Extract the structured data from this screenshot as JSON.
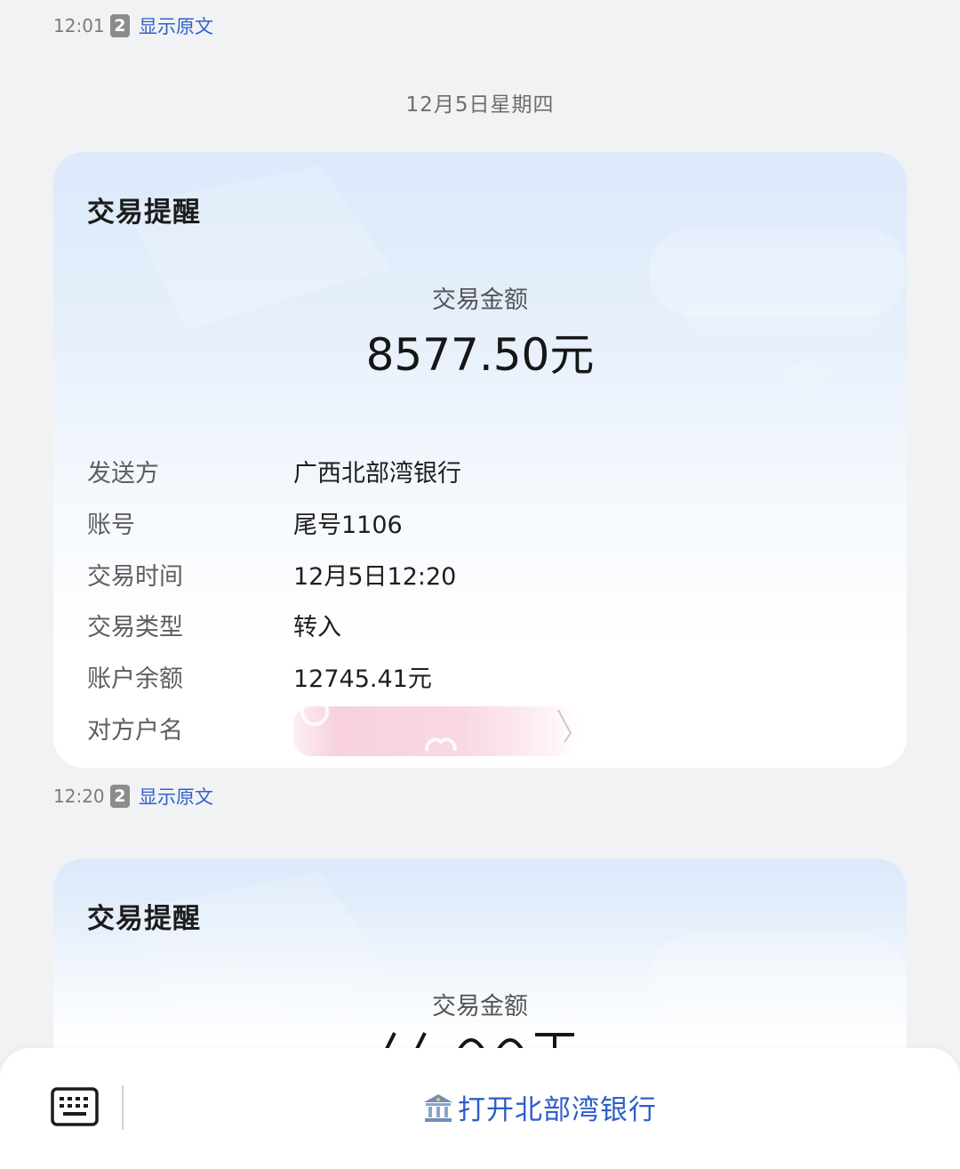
{
  "messages": [
    {
      "time": "12:01",
      "badge": "2",
      "show_original": "显示原文",
      "card": {
        "title": "交易提醒",
        "amount_label": "交易金额",
        "amount": "8577.50元",
        "rows": [
          {
            "key": "发送方",
            "value": "广西北部湾银行"
          },
          {
            "key": "账号",
            "value": "尾号1106"
          },
          {
            "key": "交易时间",
            "value": "12月5日12:20"
          },
          {
            "key": "交易类型",
            "value": "转入"
          },
          {
            "key": "账户余额",
            "value": "12745.41元"
          },
          {
            "key": "对方户名",
            "value": ""
          }
        ]
      }
    },
    {
      "time": "12:20",
      "badge": "2",
      "show_original": "显示原文",
      "card": {
        "title": "交易提醒",
        "amount_label": "交易金额"
      }
    }
  ],
  "date_separator": "12月5日星期四",
  "bottom_bar": {
    "keyboard_icon": "keyboard-icon",
    "bank_icon": "bank-icon",
    "open_bank_label": "打开北部湾银行"
  },
  "colors": {
    "link": "#2f62c9",
    "bank_action": "#2e5ec8",
    "background": "#f1f2f4"
  }
}
